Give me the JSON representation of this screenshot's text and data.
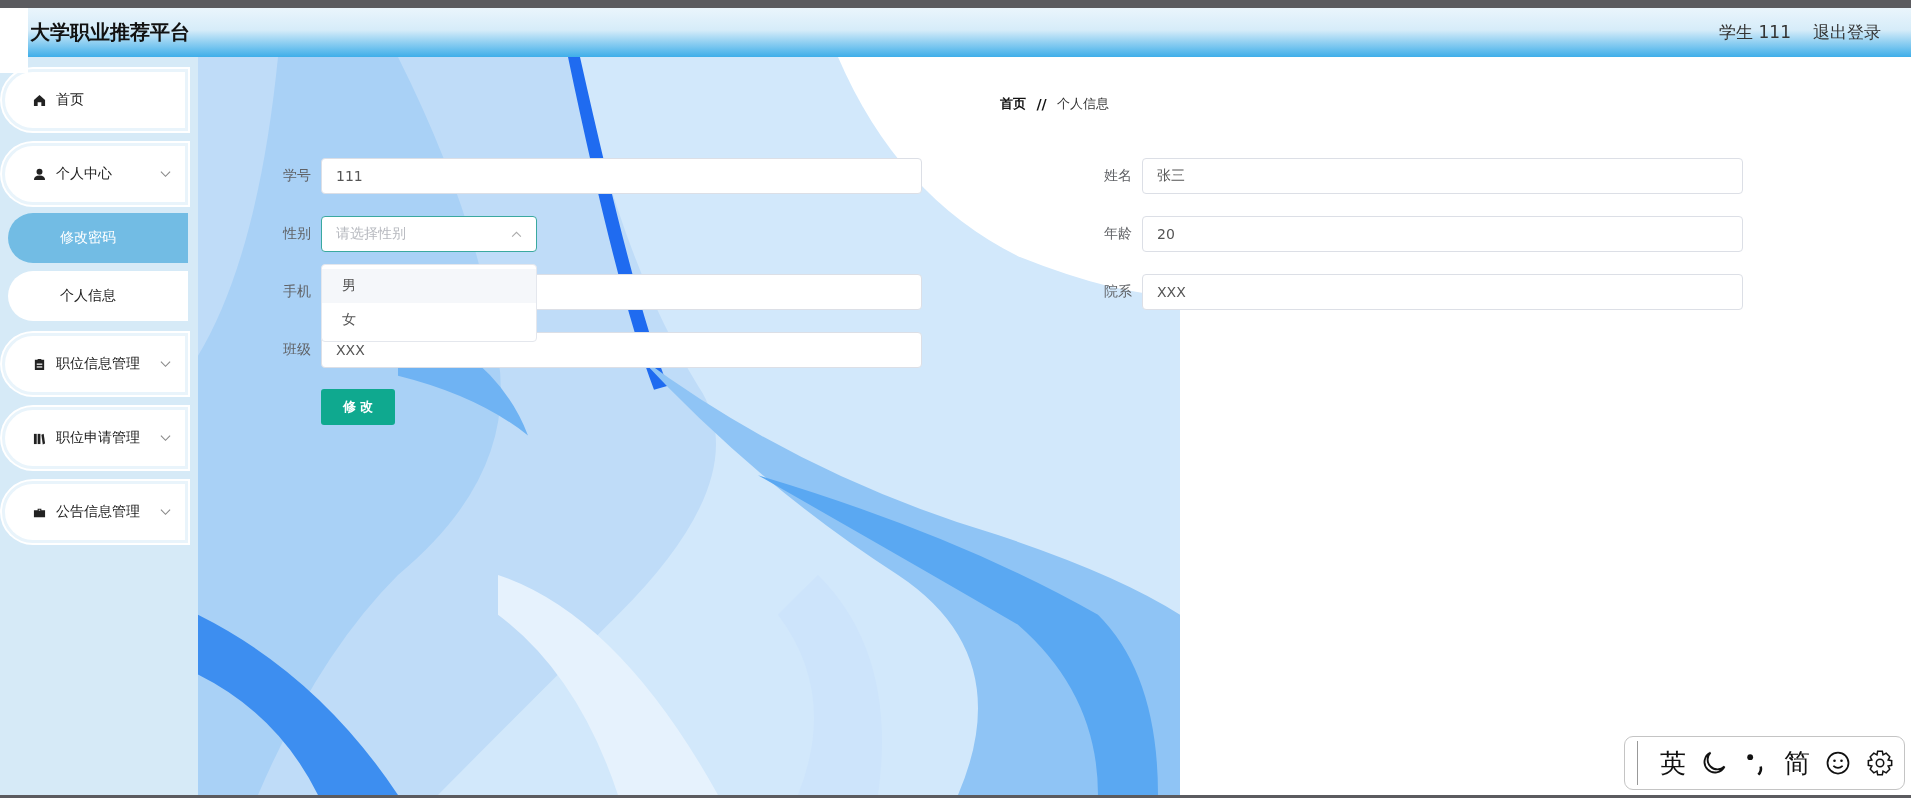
{
  "header": {
    "title": "大学职业推荐平台",
    "user": "学生 111",
    "logout": "退出登录"
  },
  "sidebar": {
    "items": [
      {
        "label": "首页",
        "kind": "link"
      },
      {
        "label": "个人中心",
        "kind": "group",
        "children": [
          {
            "label": "修改密码",
            "selected": true
          },
          {
            "label": "个人信息",
            "selected": false
          }
        ]
      },
      {
        "label": "职位信息管理",
        "kind": "group"
      },
      {
        "label": "职位申请管理",
        "kind": "group"
      },
      {
        "label": "公告信息管理",
        "kind": "group"
      }
    ]
  },
  "breadcrumb": {
    "items": [
      "首页",
      "个人信息"
    ],
    "separator": "//"
  },
  "form": {
    "left": [
      {
        "label": "学号",
        "kind": "input",
        "value": "111"
      },
      {
        "label": "性别",
        "kind": "select",
        "placeholder": "请选择性别",
        "open": true,
        "options": [
          {
            "label": "男",
            "hovered": true
          },
          {
            "label": "女",
            "hovered": false
          }
        ]
      },
      {
        "label": "手机",
        "kind": "input"
      },
      {
        "label": "班级",
        "kind": "input",
        "value": "XXX"
      }
    ],
    "right": [
      {
        "label": "姓名",
        "kind": "input",
        "value": "张三"
      },
      {
        "label": "年龄",
        "kind": "input",
        "value": "20"
      },
      {
        "label": "院系",
        "kind": "input",
        "value": "XXX"
      }
    ],
    "submit": "修 改"
  },
  "ime_toolbar": {
    "mode": "英",
    "script": "简"
  }
}
